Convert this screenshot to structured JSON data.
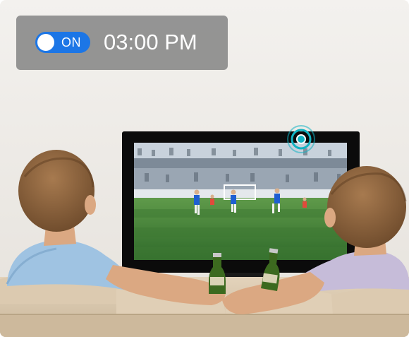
{
  "timer": {
    "toggle_state_label": "ON",
    "toggle_on": true,
    "time": "03:00 PM"
  },
  "colors": {
    "overlay": "#848484",
    "toggle_accent": "#1c76e6",
    "signal_accent": "#12b3c2"
  },
  "icons": {
    "toggle": "toggle-switch-icon",
    "signal": "ir-signal-icon"
  }
}
